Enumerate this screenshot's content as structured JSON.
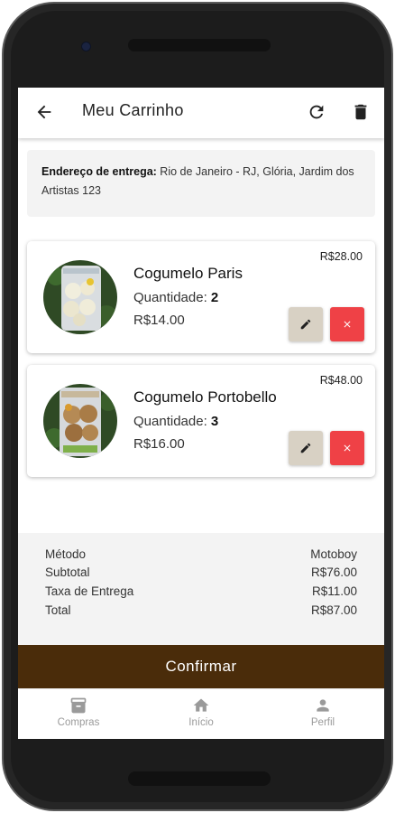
{
  "header": {
    "title": "Meu Carrinho"
  },
  "address": {
    "label": "Endereço de entrega:",
    "value": " Rio de Janeiro - RJ, Glória, Jardim dos Artistas 123"
  },
  "cart": [
    {
      "name": "Cogumelo Paris",
      "qty_label": "Quantidade:",
      "qty": "2",
      "unit_price": "R$14.00",
      "total": "R$28.00"
    },
    {
      "name": "Cogumelo Portobello",
      "qty_label": "Quantidade:",
      "qty": "3",
      "unit_price": "R$16.00",
      "total": "R$48.00"
    }
  ],
  "summary": {
    "method_label": "Método",
    "method_value": "Motoboy",
    "subtotal_label": "Subtotal",
    "subtotal_value": "R$76.00",
    "fee_label": "Taxa de Entrega",
    "fee_value": "R$11.00",
    "total_label": "Total",
    "total_value": "R$87.00"
  },
  "confirm_label": "Confirmar",
  "nav": [
    {
      "label": "Compras",
      "icon": "archive-icon"
    },
    {
      "label": "Início",
      "icon": "home-icon"
    },
    {
      "label": "Perfil",
      "icon": "person-icon"
    }
  ],
  "colors": {
    "brand": "#4a2c0a",
    "delete": "#ef4146",
    "edit": "#d8d1c4"
  }
}
